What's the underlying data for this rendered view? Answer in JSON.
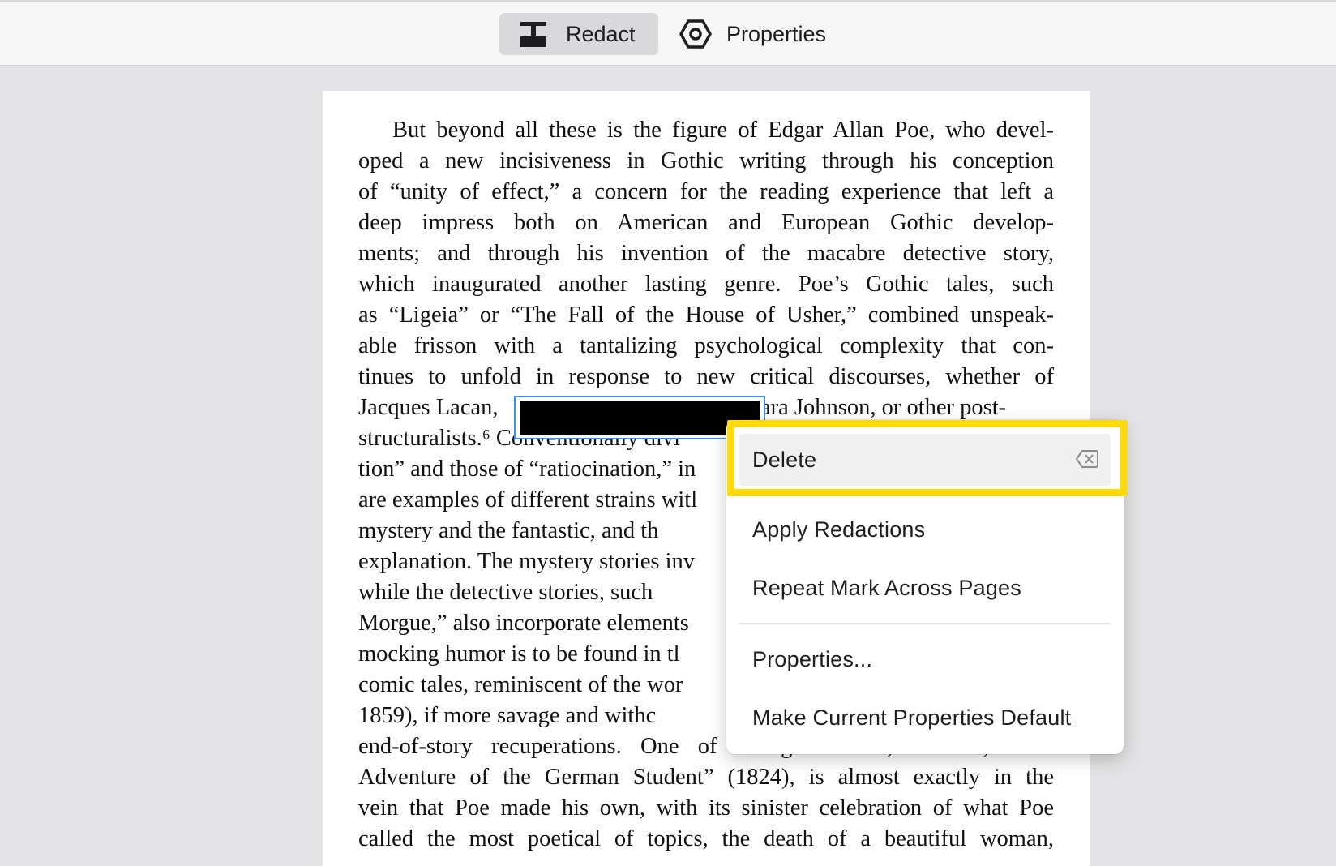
{
  "toolbar": {
    "redact_label": "Redact",
    "properties_label": "Properties",
    "redact_icon": "redact-icon",
    "properties_icon": "properties-hexagon-icon"
  },
  "document": {
    "lines": [
      "But beyond all these is the figure of Edgar Allan Poe, who devel-",
      "oped a new incisiveness in Gothic writing through his conception",
      "of “unity of effect,” a concern for the reading experience that left a",
      "deep impress both on American and European Gothic develop-",
      "ments; and through his invention of the macabre detective story,",
      "which inaugurated another lasting genre. Poe’s Gothic tales, such",
      "as “Ligeia” or “The Fall of the House of Usher,” combined unspeak-",
      "able frisson with a tantalizing psychological complexity that con-",
      "tinues to unfold in response to new critical discourses, whether of",
      "Jacques Lacan,",
      "structuralists.⁶ Conventionally divi",
      "tion” and those of “ratiocination,” in",
      "are examples of different strains witl",
      "mystery and the fantastic, and th",
      "explanation. The mystery stories inv",
      "while the detective stories, such",
      "Morgue,” also incorporate elements",
      "mocking humor is to be found in tl",
      "comic tales, reminiscent of the wor",
      "1859), if more savage and withc",
      "end-of-story recuperations. One of Irving’s stories, in fact, “The",
      "Adventure of the German Student” (1824), is almost exactly in the",
      "vein that Poe made his own, with its sinister celebration of what Poe",
      "called the most poetical of topics, the death of a beautiful woman,"
    ],
    "line10_tail": "ara Johnson, or other post-"
  },
  "context_menu": {
    "delete_label": "Delete",
    "delete_shortcut_icon": "delete-key-icon",
    "apply_label": "Apply Redactions",
    "repeat_label": "Repeat Mark Across Pages",
    "properties_label": "Properties...",
    "default_label": "Make Current Properties Default"
  },
  "colors": {
    "highlight": "#ffd90a",
    "selection": "#3d8ee8",
    "redaction": "#000000"
  }
}
